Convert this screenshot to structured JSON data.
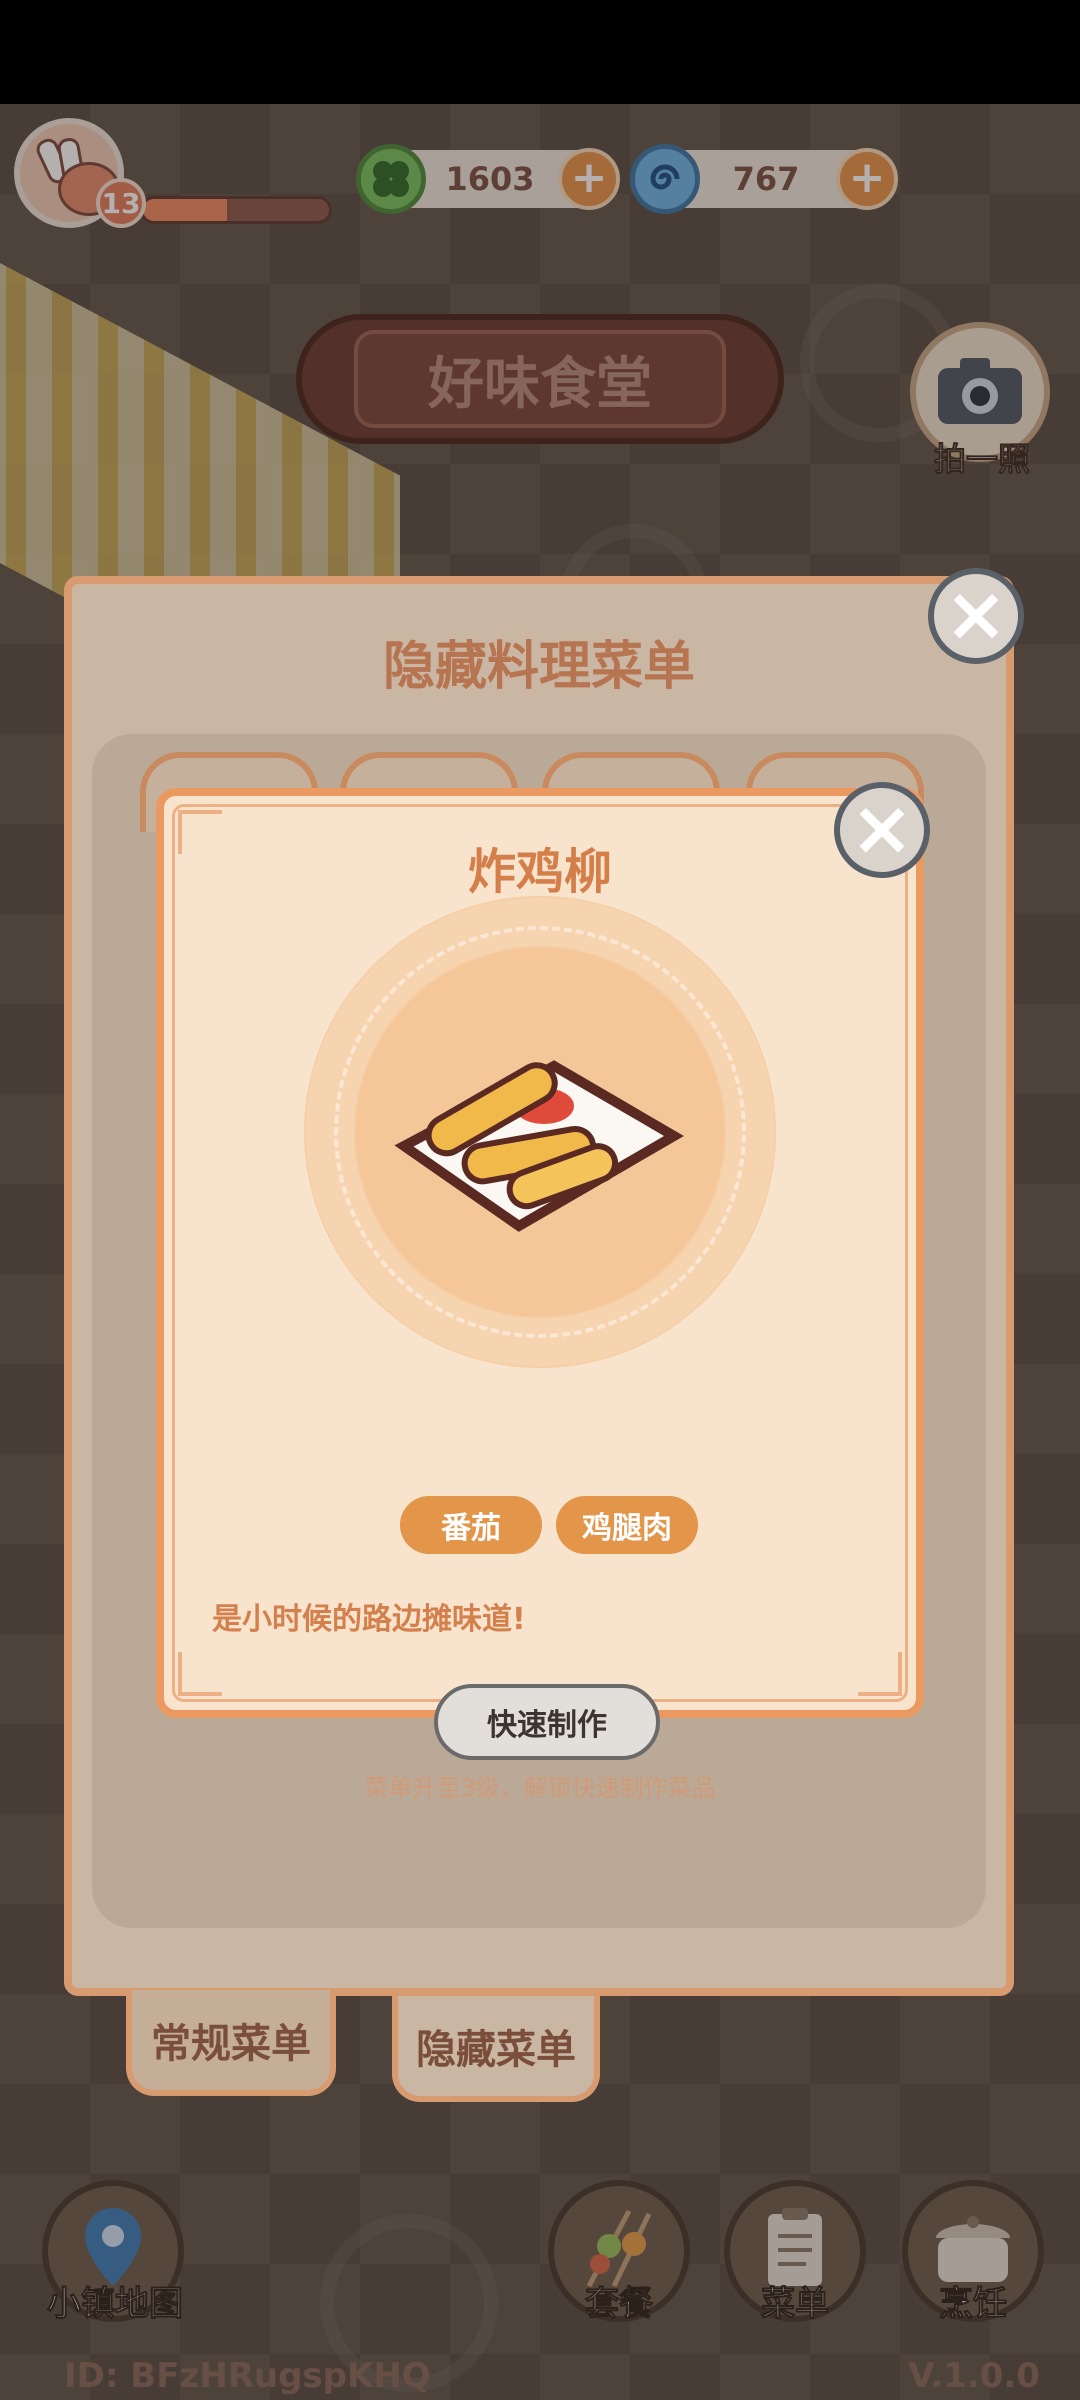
{
  "hud": {
    "level": "13",
    "xp_progress": 0.45,
    "clover_currency": "1603",
    "swirl_currency": "767"
  },
  "restaurant": {
    "sign": "好味食堂",
    "camera_label": "拍一照"
  },
  "menu_panel": {
    "title": "隐藏料理菜单",
    "tabs": [
      "常规菜单",
      "隐藏菜单"
    ],
    "selected_tab": "隐藏菜单"
  },
  "dish": {
    "name": "炸鸡柳",
    "ingredients": [
      "番茄",
      "鸡腿肉"
    ],
    "description": "是小时候的路边摊味道!",
    "quick_make_label": "快速制作",
    "unlock_hint": "菜单升至3级，解锁快速制作菜品"
  },
  "bottom_nav": {
    "map": "小镇地图",
    "set_meal": "套餐",
    "menu": "菜单",
    "cook": "烹饪"
  },
  "footer": {
    "id": "ID: BFzHRugspKHQ",
    "version": "V.1.0.0"
  },
  "colors": {
    "accent": "#e39549",
    "panel_border": "#ea9a60",
    "title": "#d47e4a"
  }
}
